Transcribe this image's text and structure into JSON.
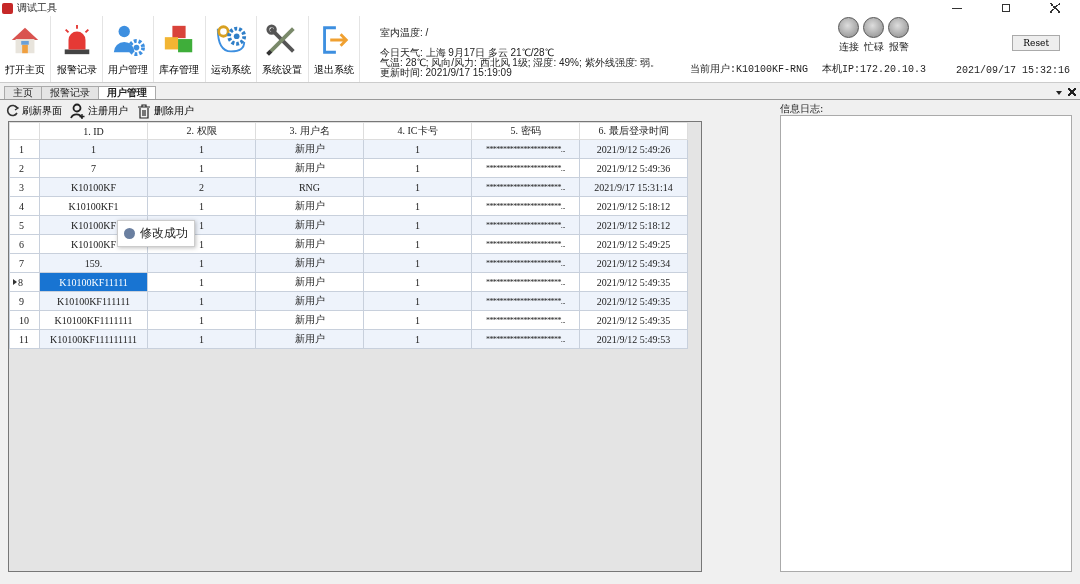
{
  "window": {
    "title": "调试工具"
  },
  "toolbar": [
    {
      "label": "打开主页"
    },
    {
      "label": "报警记录"
    },
    {
      "label": "用户管理"
    },
    {
      "label": "库存管理"
    },
    {
      "label": "运动系统"
    },
    {
      "label": "系统设置"
    },
    {
      "label": "退出系统"
    }
  ],
  "info": {
    "indoor_temp": "室内温度: /",
    "weather": "今日天气: 上海 9月17日 多云 21℃/28℃",
    "detail": "气温: 28℃; 风向/风力: 西北风 1级; 湿度: 49%; 紫外线强度: 弱。",
    "updated": "更新时间: 2021/9/17 15:19:09"
  },
  "status": {
    "current_user": "当前用户:K10100KF-RNG",
    "ip": "本机IP:172.20.10.3",
    "datetime": "2021/09/17 15:32:16"
  },
  "lights": [
    {
      "label": "连接",
      "on": false
    },
    {
      "label": "忙碌",
      "on": false
    },
    {
      "label": "报警",
      "on": false
    }
  ],
  "reset_button": "Reset",
  "tabs": [
    {
      "label": "主页",
      "selected": false
    },
    {
      "label": "报警记录",
      "selected": false
    },
    {
      "label": "用户管理",
      "selected": true
    }
  ],
  "actions": [
    {
      "label": "刷新界面"
    },
    {
      "label": "注册用户"
    },
    {
      "label": "删除用户"
    }
  ],
  "table": {
    "columns": [
      "1. ID",
      "2. 权限",
      "3. 用户名",
      "4. IC卡号",
      "5. 密码",
      "6. 最后登录时间"
    ],
    "rows": [
      {
        "number": "1",
        "selected": false,
        "cells": [
          "1",
          "1",
          "新用户",
          "1",
          "**********************...",
          "2021/9/12 5:49:26"
        ]
      },
      {
        "number": "2",
        "selected": false,
        "cells": [
          "7",
          "1",
          "新用户",
          "1",
          "**********************...",
          "2021/9/12 5:49:36"
        ]
      },
      {
        "number": "3",
        "selected": false,
        "cells": [
          "K10100KF",
          "2",
          "RNG",
          "1",
          "**********************...",
          "2021/9/17 15:31:14"
        ]
      },
      {
        "number": "4",
        "selected": false,
        "cells": [
          "K10100KF1",
          "1",
          "新用户",
          "1",
          "**********************...",
          "2021/9/12 5:18:12"
        ]
      },
      {
        "number": "5",
        "selected": false,
        "cells": [
          "K10100KF",
          "1",
          "新用户",
          "1",
          "**********************...",
          "2021/9/12 5:18:12"
        ]
      },
      {
        "number": "6",
        "selected": false,
        "cells": [
          "K10100KF",
          "1",
          "新用户",
          "1",
          "**********************...",
          "2021/9/12 5:49:25"
        ]
      },
      {
        "number": "7",
        "selected": false,
        "cells": [
          "159.",
          "1",
          "新用户",
          "1",
          "**********************...",
          "2021/9/12 5:49:34"
        ]
      },
      {
        "number": "8",
        "selected": true,
        "cells": [
          "K10100KF11111",
          "1",
          "新用户",
          "1",
          "**********************...",
          "2021/9/12 5:49:35"
        ]
      },
      {
        "number": "9",
        "selected": false,
        "cells": [
          "K10100KF111111",
          "1",
          "新用户",
          "1",
          "**********************...",
          "2021/9/12 5:49:35"
        ]
      },
      {
        "number": "10",
        "selected": false,
        "cells": [
          "K10100KF1111111",
          "1",
          "新用户",
          "1",
          "**********************...",
          "2021/9/12 5:49:35"
        ]
      },
      {
        "number": "11",
        "selected": false,
        "cells": [
          "K10100KF111111111",
          "1",
          "新用户",
          "1",
          "**********************...",
          "2021/9/12 5:49:53"
        ]
      }
    ]
  },
  "toast": {
    "text": "修改成功"
  },
  "log_panel": {
    "label": "信息日志:"
  }
}
